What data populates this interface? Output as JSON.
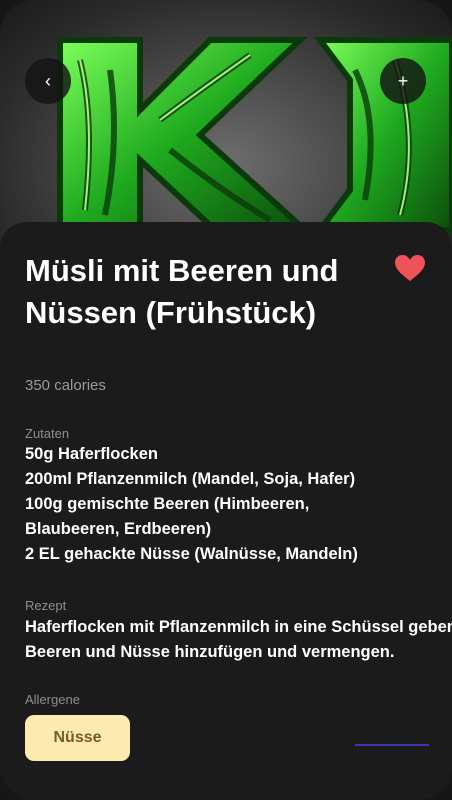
{
  "header": {
    "back_icon": "chevron-left-icon",
    "back_glyph": "‹",
    "add_icon": "plus-icon",
    "add_glyph": "+"
  },
  "recipe": {
    "title": "Müsli mit Beeren und Nüssen (Frühstück)",
    "calories": "350 calories",
    "favorite_icon": "heart-icon",
    "favorite_color": "#f0525a",
    "ingredients_label": "Zutaten",
    "ingredients": [
      "50g Haferflocken",
      "200ml Pflanzenmilch (Mandel, Soja, Hafer)",
      "100g gemischte Beeren (Himbeeren, Blaubeeren, Erdbeeren)",
      "2 EL gehackte Nüsse (Walnüsse, Mandeln)"
    ],
    "recipe_label": "Rezept",
    "recipe_text": "Haferflocken mit Pflanzenmilch in eine Schüssel geben. Beeren und Nüsse hinzufügen und vermengen.",
    "allergens_label": "Allergene",
    "allergens": [
      "Nüsse"
    ]
  },
  "colors": {
    "chip_bg": "#fdeab0",
    "chip_text": "#7a5c1e",
    "accent_green": "#2fd12f"
  }
}
